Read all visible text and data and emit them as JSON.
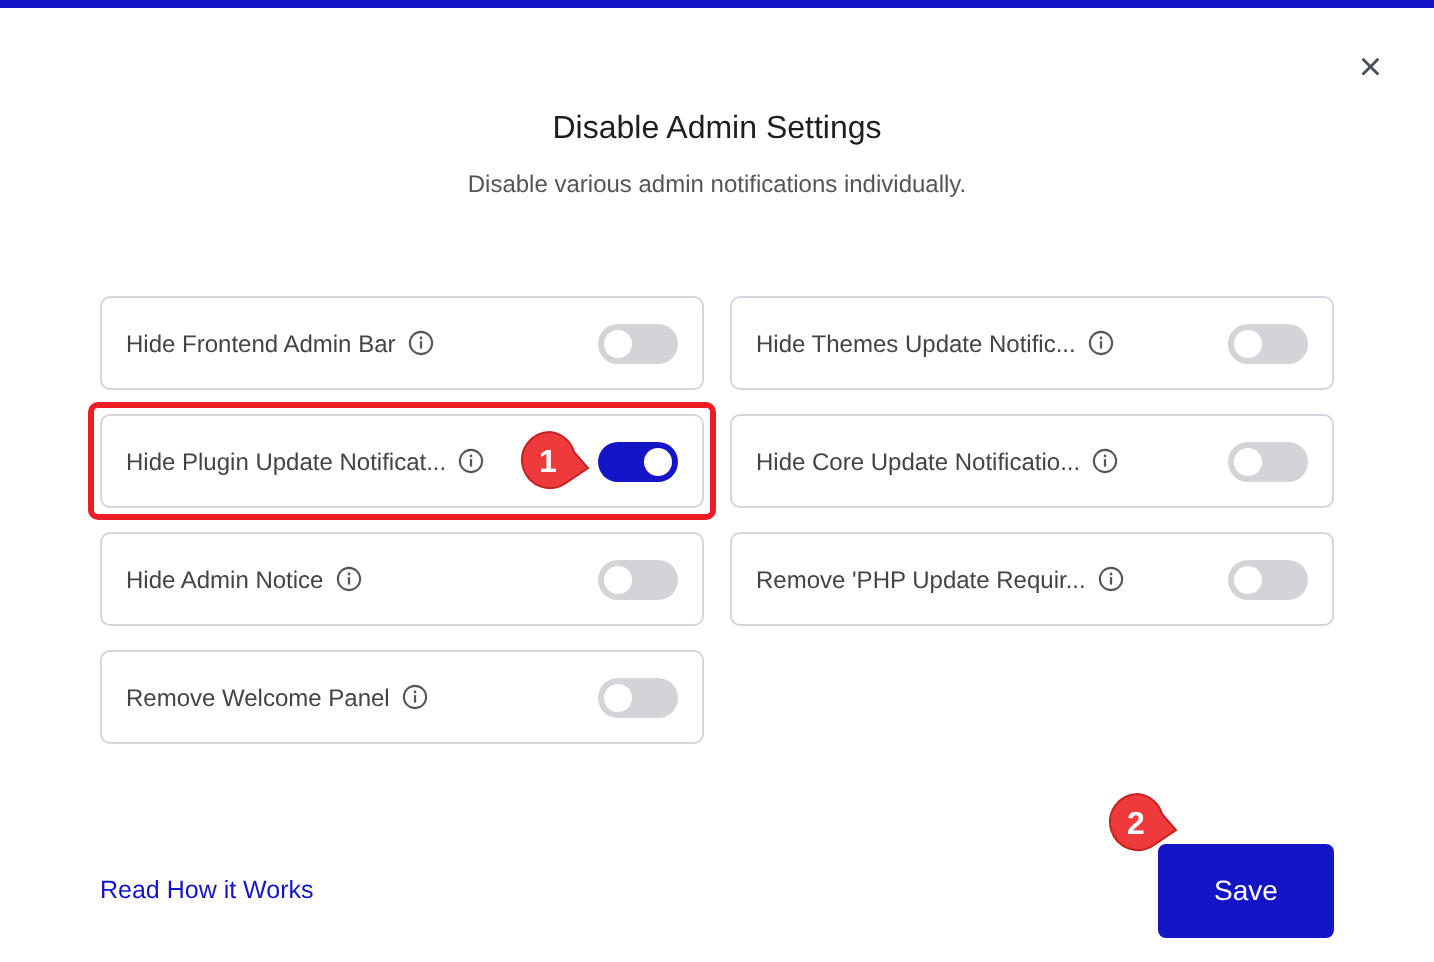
{
  "dialog": {
    "title": "Disable Admin Settings",
    "subtitle": "Disable various admin notifications individually.",
    "close": "×"
  },
  "settings": [
    {
      "label": "Hide Frontend Admin Bar",
      "on": false,
      "highlighted": false
    },
    {
      "label": "Hide Themes Update Notific...",
      "on": false,
      "highlighted": false
    },
    {
      "label": "Hide Plugin Update Notificat...",
      "on": true,
      "highlighted": true,
      "callout": "1"
    },
    {
      "label": "Hide Core Update Notificatio...",
      "on": false,
      "highlighted": false
    },
    {
      "label": "Hide Admin Notice",
      "on": false,
      "highlighted": false
    },
    {
      "label": "Remove 'PHP Update Requir...",
      "on": false,
      "highlighted": false
    },
    {
      "label": "Remove Welcome Panel",
      "on": false,
      "highlighted": false
    }
  ],
  "footer": {
    "link": "Read How it Works",
    "save": "Save",
    "save_callout": "2"
  }
}
